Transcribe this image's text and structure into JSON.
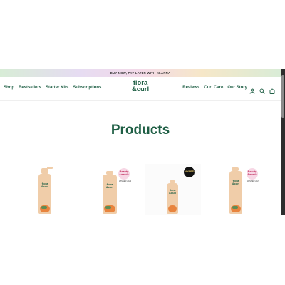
{
  "promo": {
    "text": "BUY NOW, PAY LATER WITH KLARNA"
  },
  "nav_left": [
    "Shop",
    "Bestsellers",
    "Starter Kits",
    "Subscriptions"
  ],
  "nav_right": [
    "Reviews",
    "Curl Care",
    "Our Story"
  ],
  "logo": {
    "line1": "flora",
    "line2": "&curl"
  },
  "icons": [
    "account-icon",
    "search-icon",
    "cart-icon"
  ],
  "page_title": "Products",
  "bottle_label": {
    "line1": "flora",
    "line2": "&curl"
  },
  "badges": {
    "beauty_1": "Beauty",
    "beauty_2": "Awards",
    "award_caption": "WINNER 2023",
    "dark": "AWARD"
  },
  "colors": {
    "brand_green": "#1f5f45",
    "bottle": "#f0cda9",
    "orange": "#e8843e"
  }
}
